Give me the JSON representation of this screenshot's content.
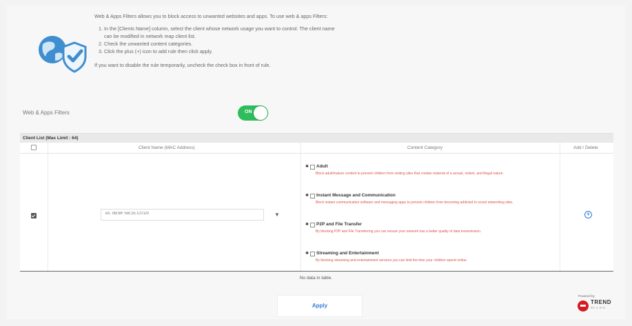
{
  "intro": {
    "text": "Web & Apps Filters allows you to block access to unwanted websites and apps. To use web & apps Filters:",
    "steps": [
      "In the [Clients Name] column, select the client whose network usage you want to control. The client name can be modified in network map client list.",
      "Check the unwanted content categories.",
      "Click the plus (+) icon to add rule then click apply."
    ],
    "note": "If you want to disable the rule temporarily, uncheck the check box in front of rule."
  },
  "toggle": {
    "label": "Web & Apps Filters",
    "state": "ON"
  },
  "table": {
    "title": "Client List (Max Limit : 64)",
    "headers": {
      "client": "Client Name (MAC Address)",
      "category": "Content Category",
      "action": "Add / Delete"
    },
    "client_placeholder": "ex. 0B:BF:5B:2E:C0:D0",
    "categories": [
      {
        "name": "Adult",
        "desc": "Block adult/mature content to prevent children from visiting sites that contain material of a sexual, violent, and illegal nature."
      },
      {
        "name": "Instant Message and Communication",
        "desc": "Block instant communication software and messaging apps to prevent children from becoming addicted to social networking sites."
      },
      {
        "name": "P2P and File Transfer",
        "desc": "By blocking P2P and File Transferring you can ensure your network has a better quality of data transmission."
      },
      {
        "name": "Streaming and Entertainment",
        "desc": "By blocking streaming and entertainment services you can limit the time your children spend online."
      }
    ],
    "empty": "No data in table."
  },
  "apply_label": "Apply",
  "brand": {
    "powered": "Powered by",
    "name": "TREND",
    "sub": "MICRO"
  },
  "colors": {
    "toggle_on": "#2dbd5a",
    "link_blue": "#3a7bd5",
    "warning_red": "#d9534f",
    "brand_red": "#d71920"
  },
  "icons": [
    "globe-shield-icon",
    "chevron-down-icon",
    "plus-circle-icon",
    "trend-micro-logo-icon"
  ]
}
